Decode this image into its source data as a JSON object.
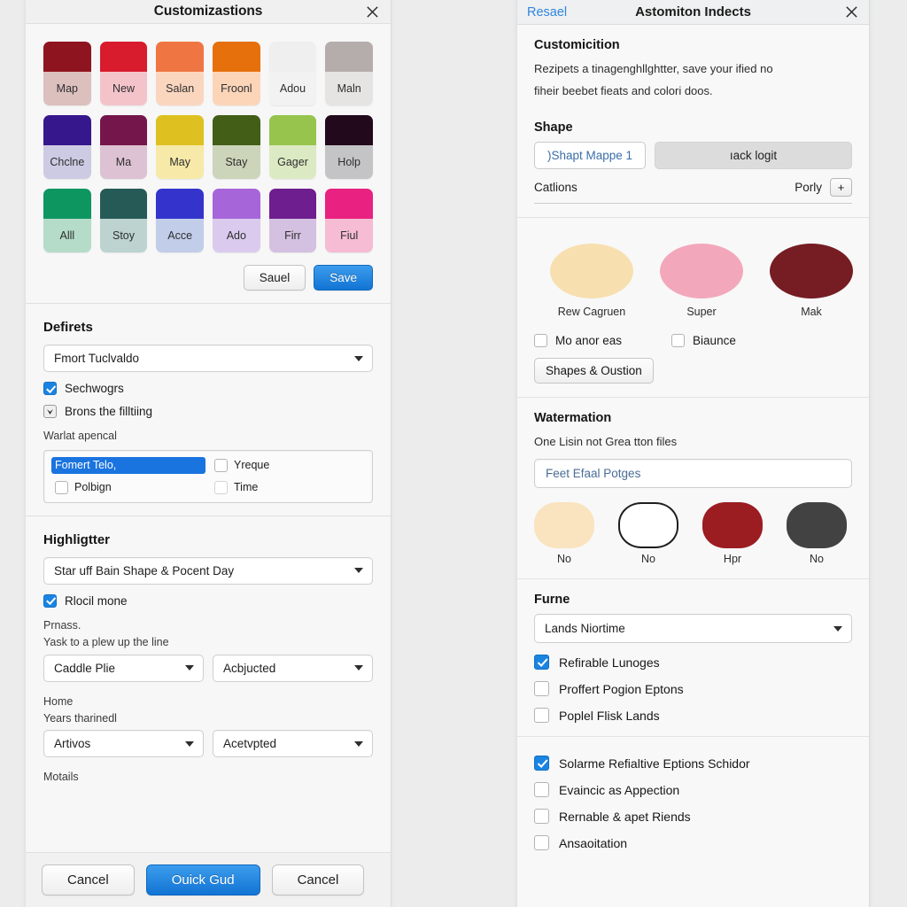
{
  "left_panel": {
    "title": "Customizastions",
    "close_icon": "close-icon",
    "swatches": [
      {
        "label": "Map",
        "top": "#8e1420",
        "bottom": "#dbc0be"
      },
      {
        "label": "New",
        "top": "#d81b2d",
        "bottom": "#f4c3ca"
      },
      {
        "label": "Salan",
        "top": "#ef7642",
        "bottom": "#fbd6bf"
      },
      {
        "label": "Froonl",
        "top": "#e6700c",
        "bottom": "#fcd5b9"
      },
      {
        "label": "Adou",
        "top": "#efeff0",
        "bottom": "#f2f2f3"
      },
      {
        "label": "Maln",
        "top": "#b4adab",
        "bottom": "#e6e4e3"
      },
      {
        "label": "Chclne",
        "top": "#36178c",
        "bottom": "#cdcbe3"
      },
      {
        "label": "Ma",
        "top": "#74164b",
        "bottom": "#dcc2d2"
      },
      {
        "label": "May",
        "top": "#dec121",
        "bottom": "#f7e9a8"
      },
      {
        "label": "Stay",
        "top": "#435e17",
        "bottom": "#ccd4ba"
      },
      {
        "label": "Gager",
        "top": "#96c44d",
        "bottom": "#dceac3"
      },
      {
        "label": "Holp",
        "top": "#22091b",
        "bottom": "#c4c4c6"
      },
      {
        "label": "Alll",
        "top": "#0e9661",
        "bottom": "#b5dcc9"
      },
      {
        "label": "Stoy",
        "top": "#255a57",
        "bottom": "#bcd3d0"
      },
      {
        "label": "Acce",
        "top": "#3434cd",
        "bottom": "#c2cdea"
      },
      {
        "label": "Ado",
        "top": "#a765da",
        "bottom": "#dacbee"
      },
      {
        "label": "Firr",
        "top": "#6e1e8e",
        "bottom": "#d4c0e0"
      },
      {
        "label": "Fiul",
        "top": "#e92180",
        "bottom": "#f6bcd3"
      }
    ],
    "swatch_buttons": {
      "secondary": "Sauel",
      "primary": "Save"
    },
    "defirets": {
      "heading": "Defirets",
      "select_value": "Fmort Tuclvaldo",
      "checkbox_1": {
        "label": "Sechwogrs",
        "checked": true
      },
      "checkbox_2": {
        "label": "Brons the filltiing",
        "checked": true
      },
      "multi_label": "Warlat apencal",
      "multi_items": [
        {
          "label": "Fomert Telo,",
          "selected": true
        },
        {
          "label": "Yreque",
          "selected": false
        },
        {
          "label": "Polbign",
          "selected": false
        },
        {
          "label": "Time",
          "selected": false
        }
      ]
    },
    "highlighter": {
      "heading": "Highligtter",
      "select_value": "Star uff Bain Shape & Pocent Day",
      "checkbox": {
        "label": "Rlocil mone",
        "checked": true
      },
      "note_line_1": "Prnass.",
      "note_line_2": "Yask to a plew up the line",
      "select_left_1": "Caddle Plie",
      "select_right_1": "Acbjucted",
      "note_line_3": "Home",
      "note_line_4": "Years tharinedl",
      "select_left_2": "Artivos",
      "select_right_2": "Acetvpted",
      "footer_note": "Motails"
    },
    "footer": {
      "cancel_left": "Cancel",
      "primary": "Ouick Gud",
      "cancel_right": "Cancel"
    }
  },
  "right_panel": {
    "back_label": "Resael",
    "title": "Astomiton Indects",
    "close_icon": "close-icon",
    "customicition": {
      "heading": "Customicition",
      "para_line_1": "Rezipets a tinagenghllghtter, save your ified no",
      "para_line_2": "fiheir beebet fieats and colori doos."
    },
    "shape": {
      "heading": "Shape",
      "seg_a": ")Shapt Mappe 1",
      "seg_b": "ıack logit",
      "caption_left": "Catlions",
      "caption_right": "Porly",
      "plus_label": "+"
    },
    "ellipses": [
      {
        "label": "Rew Cagruen",
        "color": "#f7dfb0"
      },
      {
        "label": "Super",
        "color": "#f3a7bb"
      },
      {
        "label": "Mak",
        "color": "#761c23"
      }
    ],
    "ellipse_checks": [
      {
        "label": "Mo anor eas",
        "checked": false
      },
      {
        "label": "Biaunce",
        "checked": false
      }
    ],
    "shapes_button": "Shapes & Oustion",
    "watermation": {
      "heading": "Watermation",
      "sublabel": "One Lisin not Grea tton files",
      "input_value": "Feet Efaal Potges",
      "blobs": [
        {
          "label": "No",
          "color": "#fae3bf",
          "border": "none"
        },
        {
          "label": "No",
          "color": "#ffffff",
          "border": "#1e1e1e"
        },
        {
          "label": "Hpr",
          "color": "#9b1c21",
          "border": "none"
        },
        {
          "label": "No",
          "color": "#424242",
          "border": "none"
        }
      ]
    },
    "furne": {
      "heading": "Furne",
      "select_value": "Lands Niortime",
      "checks": [
        {
          "label": "Refirable Lunoges",
          "checked": true
        },
        {
          "label": "Proffert Pogion Eptons",
          "checked": false
        },
        {
          "label": "Poplel Flisk Lands",
          "checked": false
        }
      ]
    },
    "bottom_checks": [
      {
        "label": "Solarme Refialtive Eptions Schidor",
        "checked": true
      },
      {
        "label": "Evaincic as Appection",
        "checked": false
      },
      {
        "label": "Rernable & apet Riends",
        "checked": false
      },
      {
        "label": "Ansaoitation",
        "checked": false
      }
    ]
  },
  "theme": {
    "accent_blue": "#1a84e2",
    "link_blue": "#2f86e0",
    "panel_bg": "#f7f7f7",
    "page_bg": "#ececec"
  }
}
